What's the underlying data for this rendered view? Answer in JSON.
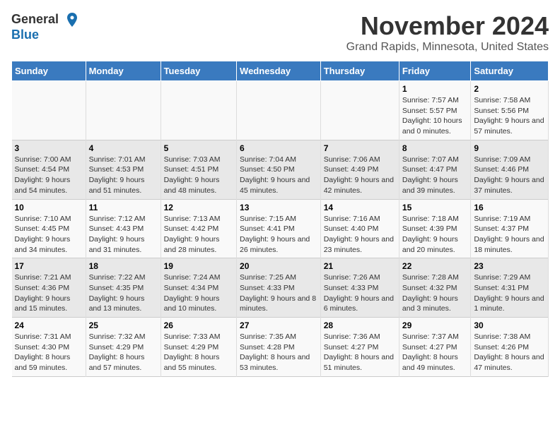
{
  "logo": {
    "line1": "General",
    "line2": "Blue"
  },
  "title": "November 2024",
  "subtitle": "Grand Rapids, Minnesota, United States",
  "headers": [
    "Sunday",
    "Monday",
    "Tuesday",
    "Wednesday",
    "Thursday",
    "Friday",
    "Saturday"
  ],
  "weeks": [
    [
      {
        "day": "",
        "sunrise": "",
        "sunset": "",
        "daylight": ""
      },
      {
        "day": "",
        "sunrise": "",
        "sunset": "",
        "daylight": ""
      },
      {
        "day": "",
        "sunrise": "",
        "sunset": "",
        "daylight": ""
      },
      {
        "day": "",
        "sunrise": "",
        "sunset": "",
        "daylight": ""
      },
      {
        "day": "",
        "sunrise": "",
        "sunset": "",
        "daylight": ""
      },
      {
        "day": "1",
        "sunrise": "Sunrise: 7:57 AM",
        "sunset": "Sunset: 5:57 PM",
        "daylight": "Daylight: 10 hours and 0 minutes."
      },
      {
        "day": "2",
        "sunrise": "Sunrise: 7:58 AM",
        "sunset": "Sunset: 5:56 PM",
        "daylight": "Daylight: 9 hours and 57 minutes."
      }
    ],
    [
      {
        "day": "3",
        "sunrise": "Sunrise: 7:00 AM",
        "sunset": "Sunset: 4:54 PM",
        "daylight": "Daylight: 9 hours and 54 minutes."
      },
      {
        "day": "4",
        "sunrise": "Sunrise: 7:01 AM",
        "sunset": "Sunset: 4:53 PM",
        "daylight": "Daylight: 9 hours and 51 minutes."
      },
      {
        "day": "5",
        "sunrise": "Sunrise: 7:03 AM",
        "sunset": "Sunset: 4:51 PM",
        "daylight": "Daylight: 9 hours and 48 minutes."
      },
      {
        "day": "6",
        "sunrise": "Sunrise: 7:04 AM",
        "sunset": "Sunset: 4:50 PM",
        "daylight": "Daylight: 9 hours and 45 minutes."
      },
      {
        "day": "7",
        "sunrise": "Sunrise: 7:06 AM",
        "sunset": "Sunset: 4:49 PM",
        "daylight": "Daylight: 9 hours and 42 minutes."
      },
      {
        "day": "8",
        "sunrise": "Sunrise: 7:07 AM",
        "sunset": "Sunset: 4:47 PM",
        "daylight": "Daylight: 9 hours and 39 minutes."
      },
      {
        "day": "9",
        "sunrise": "Sunrise: 7:09 AM",
        "sunset": "Sunset: 4:46 PM",
        "daylight": "Daylight: 9 hours and 37 minutes."
      }
    ],
    [
      {
        "day": "10",
        "sunrise": "Sunrise: 7:10 AM",
        "sunset": "Sunset: 4:45 PM",
        "daylight": "Daylight: 9 hours and 34 minutes."
      },
      {
        "day": "11",
        "sunrise": "Sunrise: 7:12 AM",
        "sunset": "Sunset: 4:43 PM",
        "daylight": "Daylight: 9 hours and 31 minutes."
      },
      {
        "day": "12",
        "sunrise": "Sunrise: 7:13 AM",
        "sunset": "Sunset: 4:42 PM",
        "daylight": "Daylight: 9 hours and 28 minutes."
      },
      {
        "day": "13",
        "sunrise": "Sunrise: 7:15 AM",
        "sunset": "Sunset: 4:41 PM",
        "daylight": "Daylight: 9 hours and 26 minutes."
      },
      {
        "day": "14",
        "sunrise": "Sunrise: 7:16 AM",
        "sunset": "Sunset: 4:40 PM",
        "daylight": "Daylight: 9 hours and 23 minutes."
      },
      {
        "day": "15",
        "sunrise": "Sunrise: 7:18 AM",
        "sunset": "Sunset: 4:39 PM",
        "daylight": "Daylight: 9 hours and 20 minutes."
      },
      {
        "day": "16",
        "sunrise": "Sunrise: 7:19 AM",
        "sunset": "Sunset: 4:37 PM",
        "daylight": "Daylight: 9 hours and 18 minutes."
      }
    ],
    [
      {
        "day": "17",
        "sunrise": "Sunrise: 7:21 AM",
        "sunset": "Sunset: 4:36 PM",
        "daylight": "Daylight: 9 hours and 15 minutes."
      },
      {
        "day": "18",
        "sunrise": "Sunrise: 7:22 AM",
        "sunset": "Sunset: 4:35 PM",
        "daylight": "Daylight: 9 hours and 13 minutes."
      },
      {
        "day": "19",
        "sunrise": "Sunrise: 7:24 AM",
        "sunset": "Sunset: 4:34 PM",
        "daylight": "Daylight: 9 hours and 10 minutes."
      },
      {
        "day": "20",
        "sunrise": "Sunrise: 7:25 AM",
        "sunset": "Sunset: 4:33 PM",
        "daylight": "Daylight: 9 hours and 8 minutes."
      },
      {
        "day": "21",
        "sunrise": "Sunrise: 7:26 AM",
        "sunset": "Sunset: 4:33 PM",
        "daylight": "Daylight: 9 hours and 6 minutes."
      },
      {
        "day": "22",
        "sunrise": "Sunrise: 7:28 AM",
        "sunset": "Sunset: 4:32 PM",
        "daylight": "Daylight: 9 hours and 3 minutes."
      },
      {
        "day": "23",
        "sunrise": "Sunrise: 7:29 AM",
        "sunset": "Sunset: 4:31 PM",
        "daylight": "Daylight: 9 hours and 1 minute."
      }
    ],
    [
      {
        "day": "24",
        "sunrise": "Sunrise: 7:31 AM",
        "sunset": "Sunset: 4:30 PM",
        "daylight": "Daylight: 8 hours and 59 minutes."
      },
      {
        "day": "25",
        "sunrise": "Sunrise: 7:32 AM",
        "sunset": "Sunset: 4:29 PM",
        "daylight": "Daylight: 8 hours and 57 minutes."
      },
      {
        "day": "26",
        "sunrise": "Sunrise: 7:33 AM",
        "sunset": "Sunset: 4:29 PM",
        "daylight": "Daylight: 8 hours and 55 minutes."
      },
      {
        "day": "27",
        "sunrise": "Sunrise: 7:35 AM",
        "sunset": "Sunset: 4:28 PM",
        "daylight": "Daylight: 8 hours and 53 minutes."
      },
      {
        "day": "28",
        "sunrise": "Sunrise: 7:36 AM",
        "sunset": "Sunset: 4:27 PM",
        "daylight": "Daylight: 8 hours and 51 minutes."
      },
      {
        "day": "29",
        "sunrise": "Sunrise: 7:37 AM",
        "sunset": "Sunset: 4:27 PM",
        "daylight": "Daylight: 8 hours and 49 minutes."
      },
      {
        "day": "30",
        "sunrise": "Sunrise: 7:38 AM",
        "sunset": "Sunset: 4:26 PM",
        "daylight": "Daylight: 8 hours and 47 minutes."
      }
    ]
  ]
}
